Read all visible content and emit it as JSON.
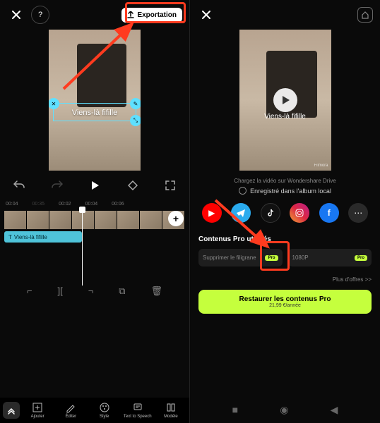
{
  "left": {
    "export_label": "Exportation",
    "overlay_text": "Viens-là fifille",
    "timecode_current": "00:04",
    "timecode_total": "00:35",
    "marks": [
      "00:02",
      "00:04",
      "00:06"
    ],
    "clip_label": "Viens-là fifille",
    "bottombar": {
      "add": "Ajouter",
      "edit": "Éditer",
      "style": "Style",
      "tts": "Text to Speech",
      "model": "Modèle"
    }
  },
  "right": {
    "overlay_text": "Viens-là fifille",
    "watermark": "Filmora",
    "upload_line": "Chargez la vidéo sur Wondershare Drive",
    "save_local": "Enregistré dans l'album local",
    "pro_title": "Contenus Pro utilisés",
    "pro_badge": "Pro",
    "remove_wm": "Supprimer le filigrane",
    "resolution": "1080P",
    "more_offers": "Plus d'offres >>",
    "restore_title": "Restaurer les contenus Pro",
    "restore_price": "21,99 €/année"
  }
}
